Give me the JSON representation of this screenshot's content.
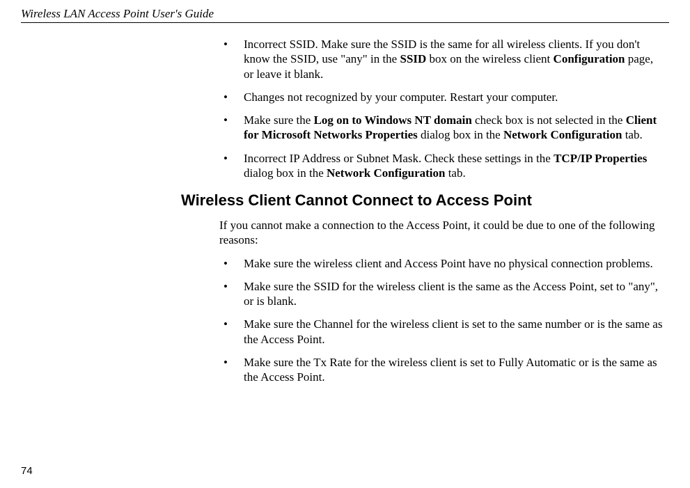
{
  "header": {
    "title": "Wireless LAN Access Point User's Guide"
  },
  "page_number": "74",
  "section1_bullets": [
    {
      "pre": "Incorrect SSID. Make sure the SSID is the same for all wireless clients. If you don't know the SSID, use \"any\" in the ",
      "b1": "SSID",
      "mid1": " box on the wireless client ",
      "b2": "Configuration",
      "post": " page, or leave it blank."
    },
    {
      "text": "Changes not recognized by your computer. Restart your computer."
    },
    {
      "pre": "Make sure the ",
      "b1": "Log on to Windows NT domain",
      "mid1": " check box is not selected in the ",
      "b2": "Client for Microsoft Networks Properties",
      "mid2": " dialog box in the ",
      "b3": "Network Configuration",
      "post": " tab."
    },
    {
      "pre": "Incorrect IP Address or Subnet Mask. Check these settings in the ",
      "b1": "TCP/IP Properties",
      "mid1": " dialog box in the ",
      "b2": "Network Configuration",
      "post": " tab."
    }
  ],
  "section2": {
    "heading": "Wireless Client Cannot Connect to Access Point",
    "intro": "If you cannot make a connection to the Access Point, it could be due to one of the following reasons:",
    "bullets": [
      "Make sure the wireless client and Access Point have no physical connection problems.",
      "Make sure the SSID for the wireless client is the same as the Access Point, set to \"any\", or is blank.",
      "Make sure the Channel for the wireless client is set to the same number or is the same as the Access Point.",
      "Make sure the Tx Rate for the wireless client is set to Fully Automatic or is the same as the Access Point."
    ]
  }
}
